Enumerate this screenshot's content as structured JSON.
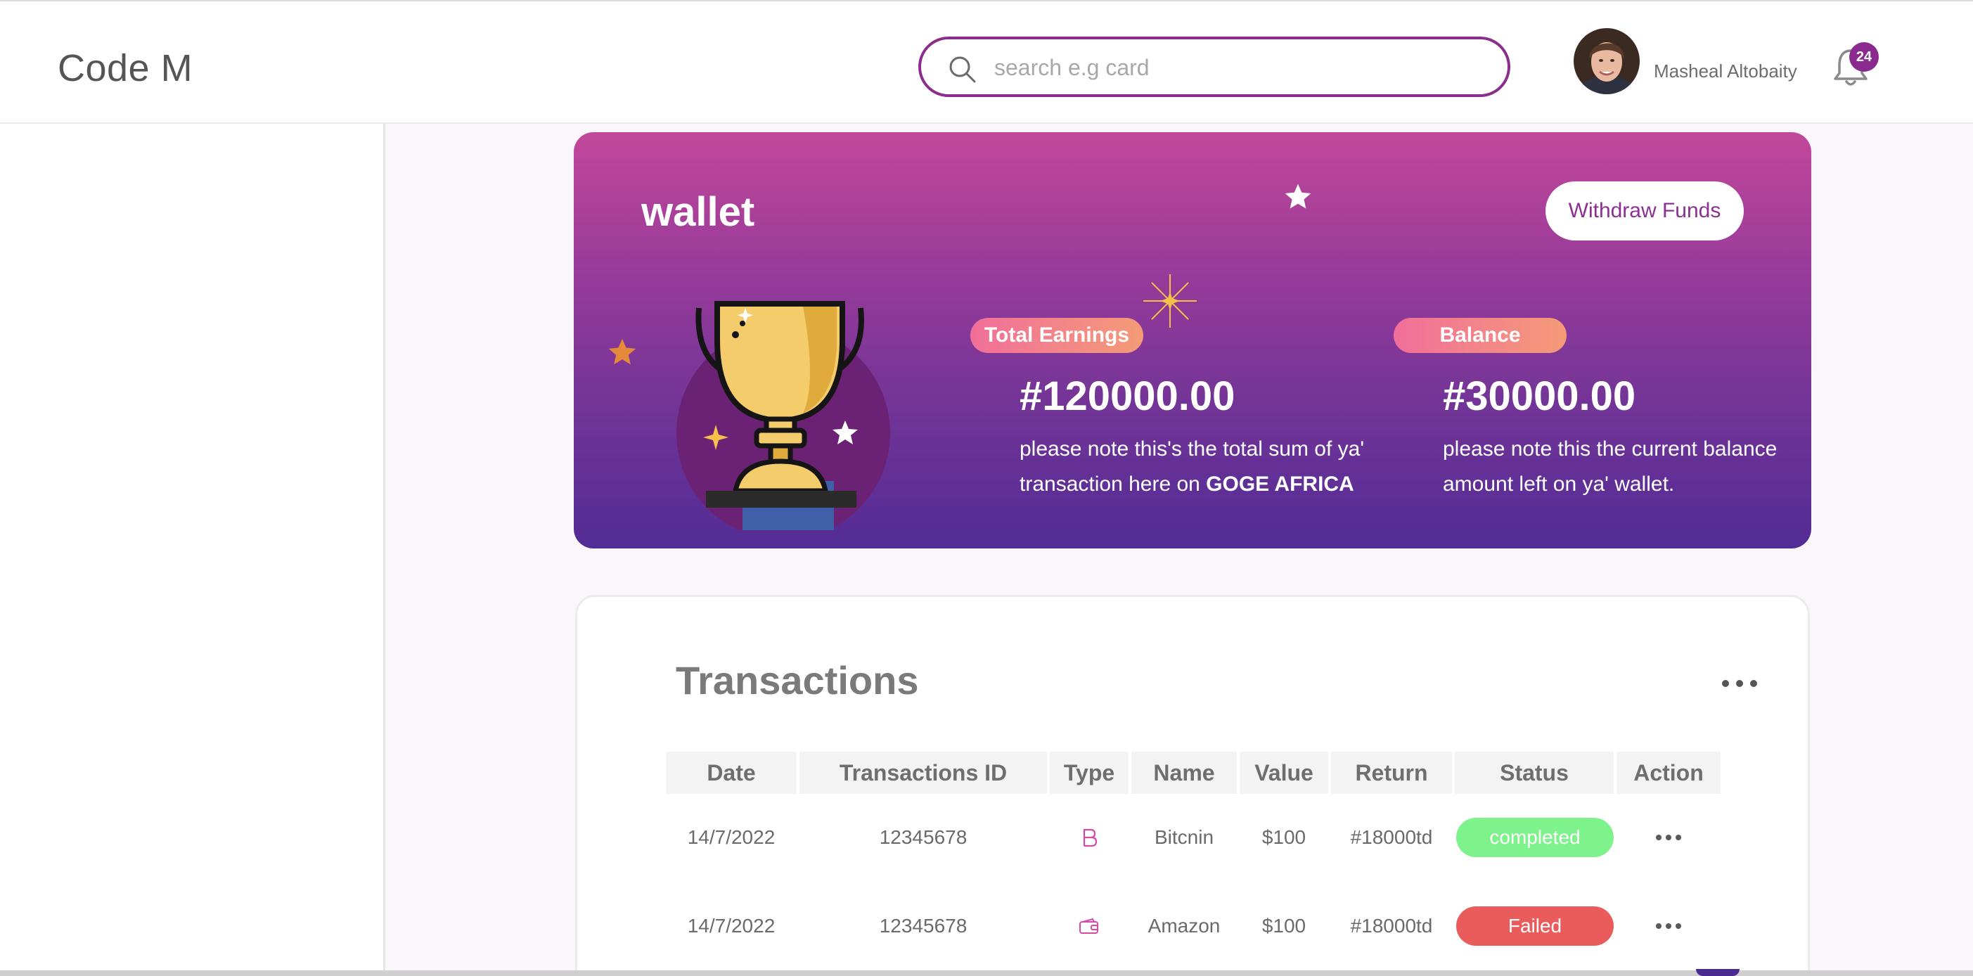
{
  "app": {
    "brand": "Code M"
  },
  "search": {
    "placeholder": "search e.g card"
  },
  "user": {
    "name": "Masheal Altobaity",
    "notifications": "24"
  },
  "wallet": {
    "title": "wallet",
    "withdraw_label": "Withdraw Funds",
    "earnings": {
      "label": "Total Earnings",
      "amount": "#120000.00",
      "note_prefix": "please note this's the total sum of ya' transaction here on ",
      "note_strong": "GOGE AFRICA"
    },
    "balance": {
      "label": "Balance",
      "amount": "#30000.00",
      "note": "please note this the current balance amount left on ya' wallet."
    }
  },
  "transactions": {
    "title": "Transactions",
    "columns": [
      "Date",
      "Transactions ID",
      "Type",
      "Name",
      "Value",
      "Return",
      "Status",
      "Action"
    ],
    "rows": [
      {
        "date": "14/7/2022",
        "id": "12345678",
        "type_icon": "bitcoin-icon",
        "name": "Bitcnin",
        "value": "$100",
        "return": "#18000td",
        "status": "completed",
        "status_color": "#7ef28b"
      },
      {
        "date": "14/7/2022",
        "id": "12345678",
        "type_icon": "wallet-icon",
        "name": "Amazon",
        "value": "$100",
        "return": "#18000td",
        "status": "Failed",
        "status_color": "#ea5b5b"
      }
    ]
  },
  "colors": {
    "accent": "#8b2e8b",
    "wallet_top": "#c2489b",
    "wallet_bottom": "#522c95",
    "pill_start": "#f16f9a",
    "pill_end": "#f49b78"
  }
}
